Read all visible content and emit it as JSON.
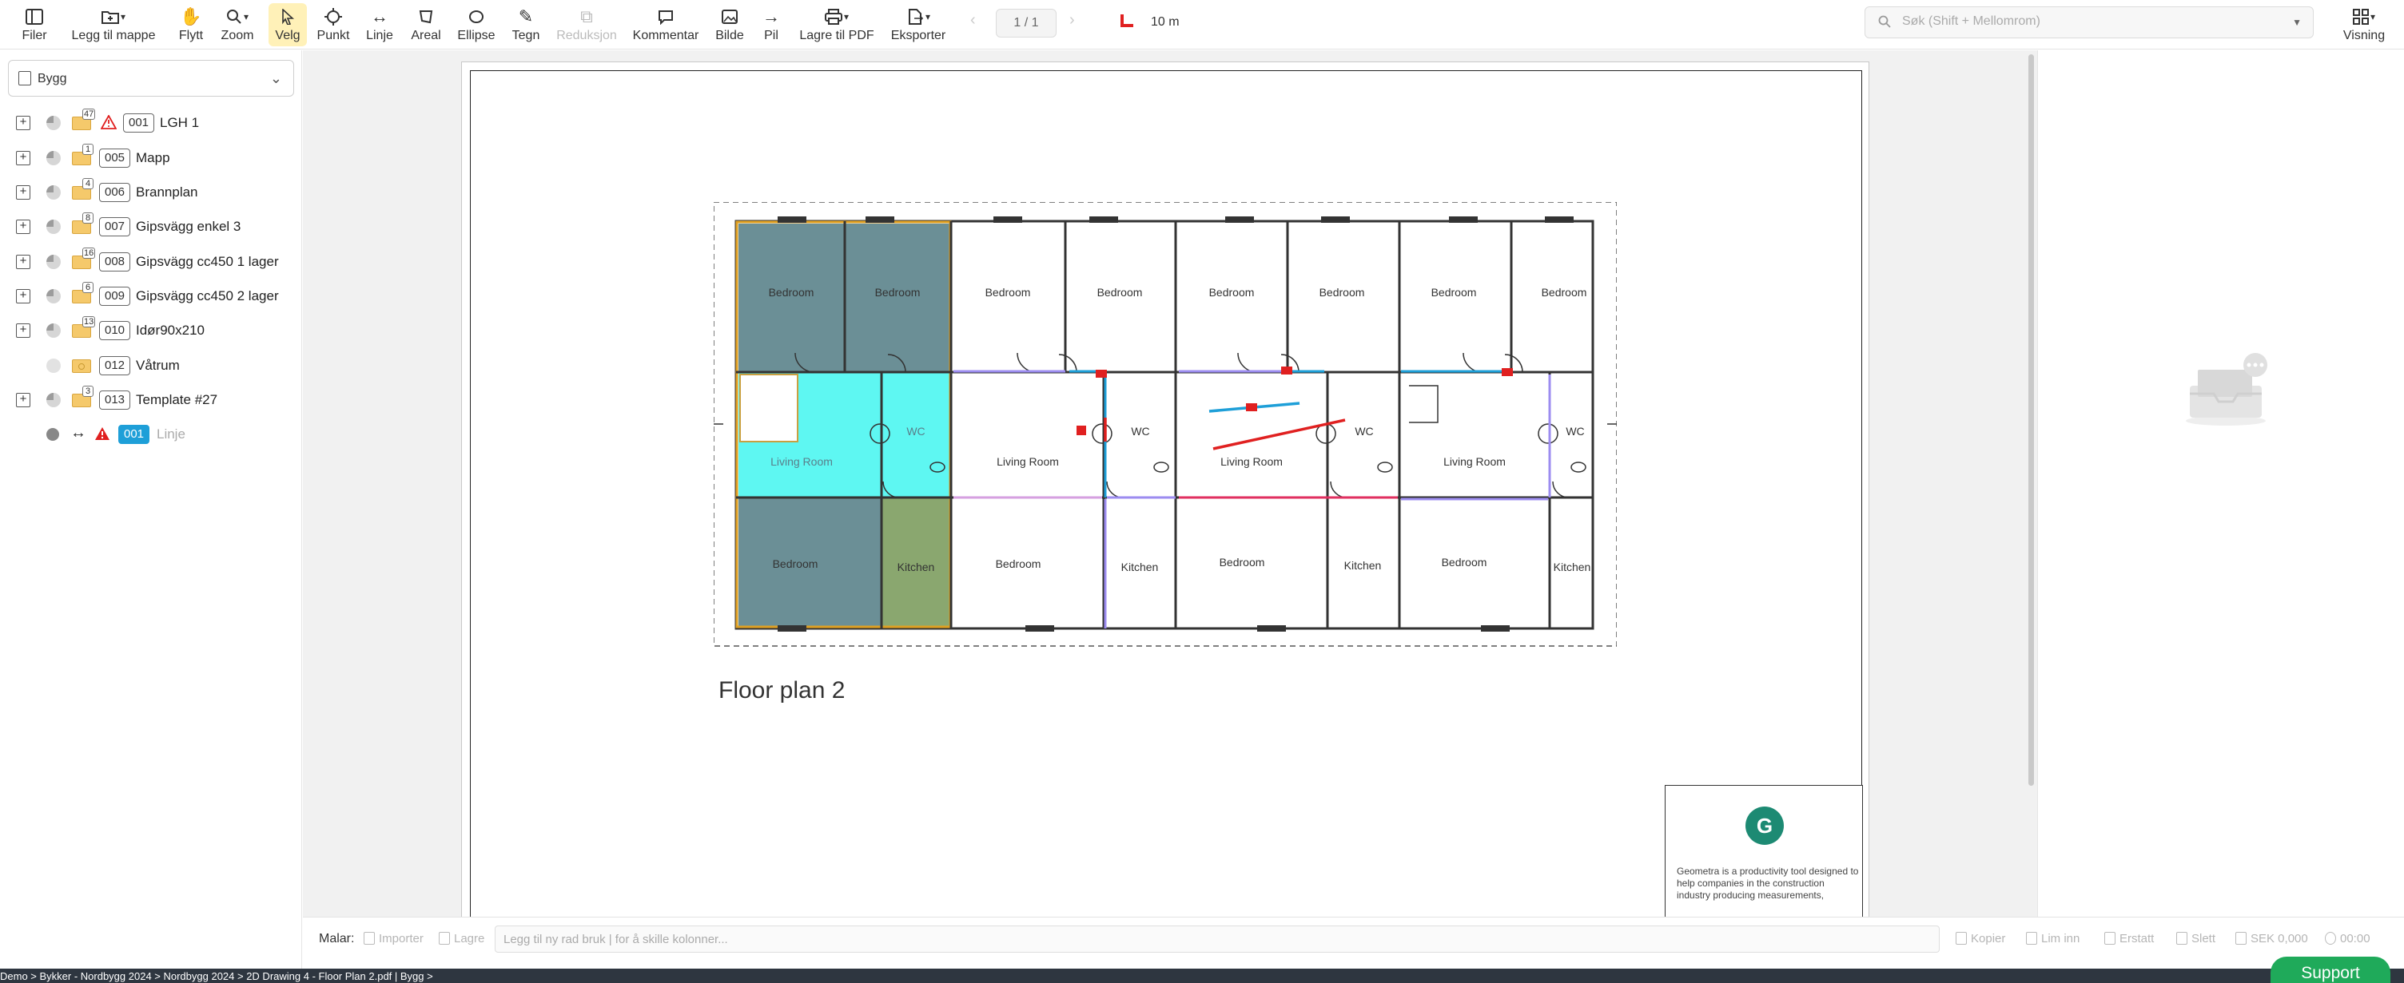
{
  "toolbar": {
    "items": [
      {
        "label": "Filer",
        "icon": "sidebar-panel-icon"
      },
      {
        "label": "Legg til mappe",
        "icon": "folder-add-icon"
      },
      {
        "label": "Flytt",
        "icon": "hand-icon"
      },
      {
        "label": "Zoom",
        "icon": "magnifier-icon"
      },
      {
        "label": "Velg",
        "icon": "cursor-icon"
      },
      {
        "label": "Punkt",
        "icon": "crosshair-icon"
      },
      {
        "label": "Linje",
        "icon": "double-arrow-icon"
      },
      {
        "label": "Areal",
        "icon": "polygon-icon"
      },
      {
        "label": "Ellipse",
        "icon": "ellipse-icon"
      },
      {
        "label": "Tegn",
        "icon": "pen-icon"
      },
      {
        "label": "Reduksjon",
        "icon": "copy-icon"
      },
      {
        "label": "Kommentar",
        "icon": "comment-icon"
      },
      {
        "label": "Bilde",
        "icon": "image-icon"
      },
      {
        "label": "Pil",
        "icon": "arrow-right-icon"
      },
      {
        "label": "Lagre til PDF",
        "icon": "printer-icon"
      },
      {
        "label": "Eksporter",
        "icon": "export-icon"
      },
      {
        "label": "Visning",
        "icon": "grid-view-icon"
      }
    ],
    "page_indicator": "1 / 1",
    "scale": "10 m",
    "search_placeholder": "Søk (Shift + Mellomrom)"
  },
  "sidebar": {
    "project": "Bygg",
    "items": [
      {
        "code": "001",
        "label": "LGH 1",
        "count": "47",
        "warning": true
      },
      {
        "code": "005",
        "label": "Mapp",
        "count": "1"
      },
      {
        "code": "006",
        "label": "Brannplan",
        "count": "4"
      },
      {
        "code": "007",
        "label": "Gipsvägg enkel 3",
        "count": "8"
      },
      {
        "code": "008",
        "label": "Gipsvägg cc450 1 lager",
        "count": "16"
      },
      {
        "code": "009",
        "label": "Gipsvägg cc450 2 lager",
        "count": "6"
      },
      {
        "code": "010",
        "label": "Idør90x210",
        "count": "13"
      },
      {
        "code": "012",
        "label": "Våtrum",
        "count": ""
      },
      {
        "code": "013",
        "label": "Template #27",
        "count": "3"
      },
      {
        "code": "001",
        "label": "Linje",
        "count": "",
        "warning": true,
        "selected": true
      }
    ]
  },
  "drawing": {
    "title": "Floor plan 2",
    "rooms": {
      "bedroom": "Bedroom",
      "living": "Living Room",
      "wc": "WC",
      "kitchen": "Kitchen"
    },
    "titleblock_logo": "G",
    "titleblock_text": "Geometra is a productivity tool designed to help companies in the construction industry producing measurements,"
  },
  "bottombar": {
    "templates_label": "Malar:",
    "import": "Importer",
    "save": "Lagre",
    "input_placeholder": "Legg til ny rad bruk | for å skille kolonner...",
    "copy": "Kopier",
    "paste": "Lim inn",
    "replace": "Erstatt",
    "delete": "Slett",
    "currency": "SEK 0,000",
    "time": "00:00"
  },
  "statusbar": {
    "breadcrumb": "Demo > Bykker - Nordbygg 2024 > Nordbygg 2024 > 2D Drawing 4 - Floor Plan 2.pdf  |  Bygg >"
  },
  "support": "Support",
  "colors": {
    "accent": "#1e9fd8",
    "active": "#fff1b8",
    "brand": "#1d8a73",
    "support": "#1faa5a"
  }
}
